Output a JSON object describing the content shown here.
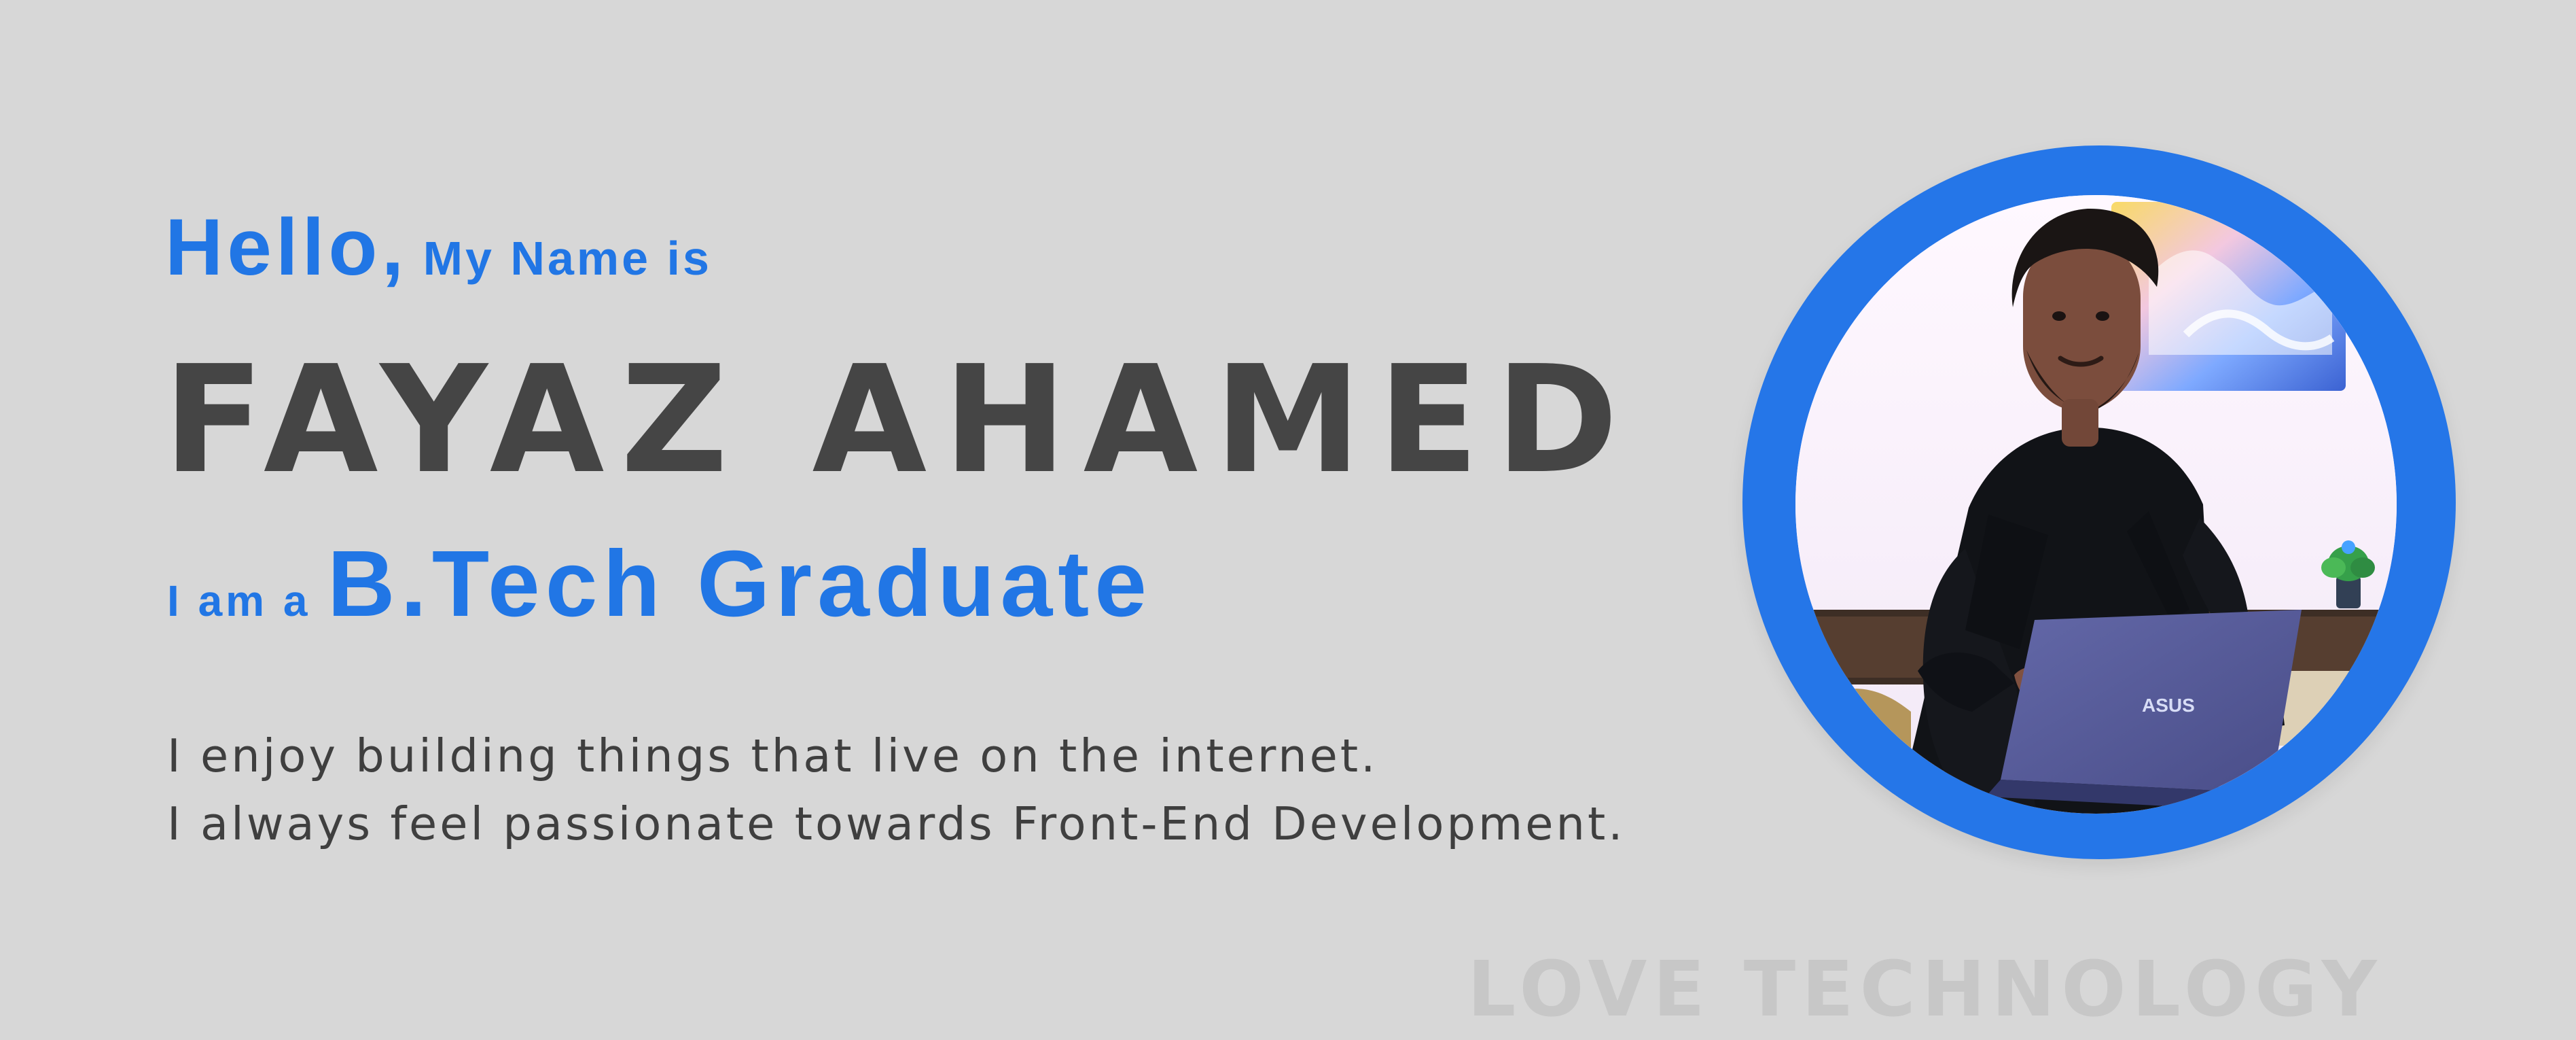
{
  "intro": {
    "greeting": "Hello,",
    "greeting_suffix": "My Name is",
    "name": "FAYAZ AHAMED",
    "role_prefix": "I am a",
    "role_title": "B.Tech Graduate",
    "bio": [
      "I enjoy building things that live on the internet.",
      "I always feel passionate towards Front-End Development."
    ]
  },
  "watermark": "LOVE TECHNOLOGY",
  "colors": {
    "background": "#d7d7d7",
    "accent": "#2176e5",
    "heading": "#454545",
    "body": "#3f3f3f"
  },
  "photo": {
    "laptop_brand": "ASUS"
  }
}
